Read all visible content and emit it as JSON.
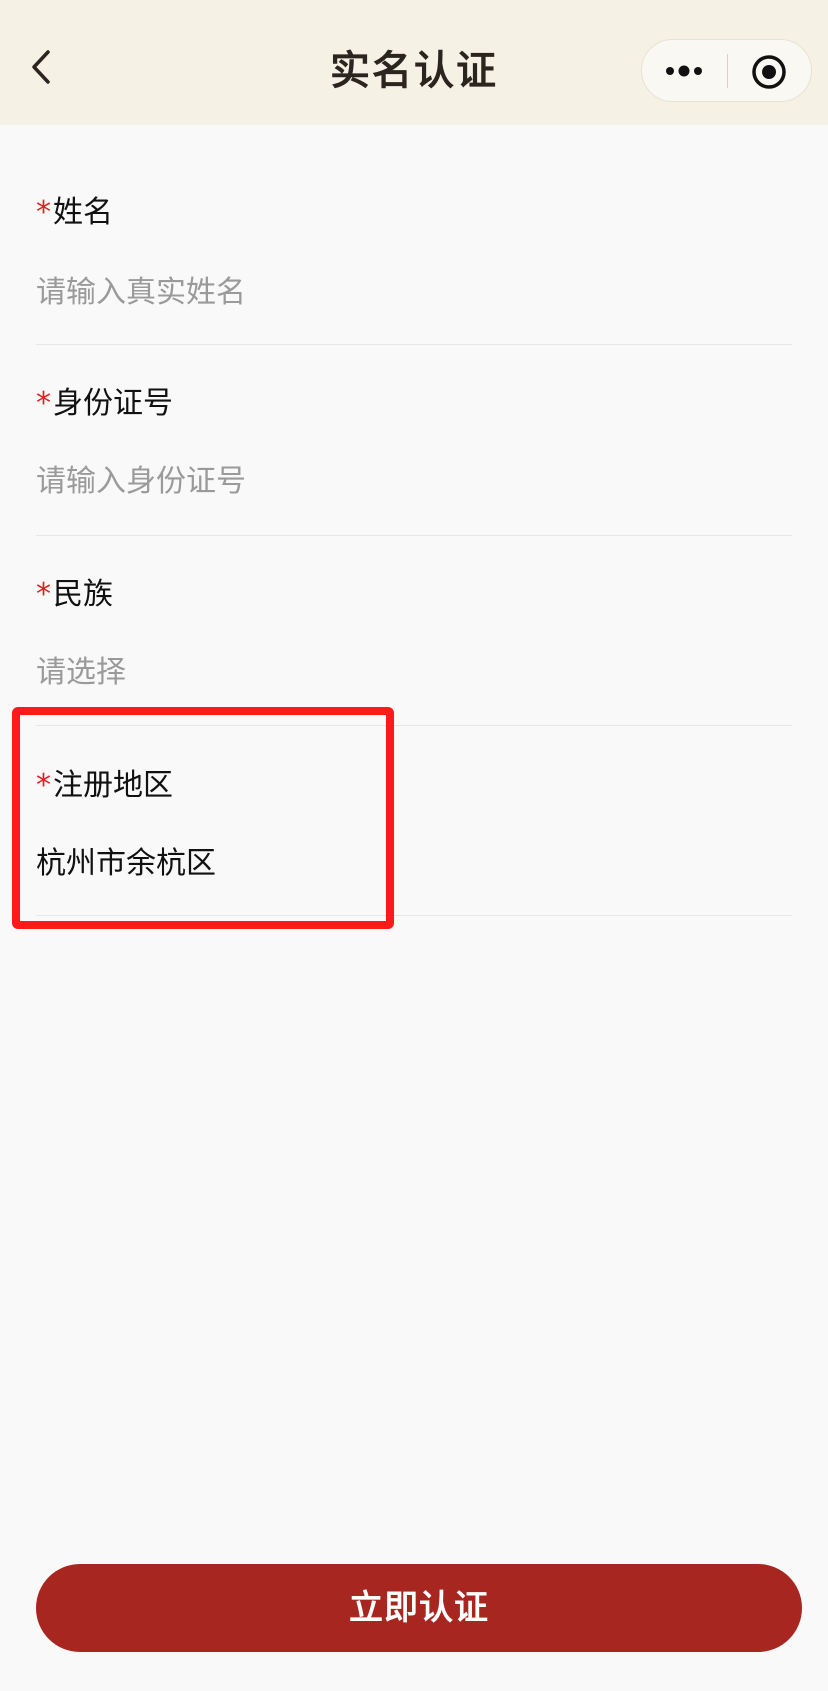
{
  "nav": {
    "title": "实名认证",
    "back_icon": "chevron-left-icon",
    "more_icon": "more-dots-icon",
    "close_icon": "target-close-icon"
  },
  "form": {
    "required_marker": "*",
    "fields": [
      {
        "label": "姓名",
        "placeholder": "请输入真实姓名",
        "value": ""
      },
      {
        "label": "身份证号",
        "placeholder": "请输入身份证号",
        "value": ""
      },
      {
        "label": "民族",
        "placeholder": "请选择",
        "value": ""
      },
      {
        "label": "注册地区",
        "placeholder": "",
        "value": "杭州市余杭区"
      }
    ]
  },
  "submit": {
    "label": "立即认证"
  },
  "colors": {
    "nav_bg": "#f6f1e5",
    "page_bg": "#f9f9f9",
    "required": "#e02020",
    "button_bg": "#a82620",
    "highlight": "#ff1a1a"
  }
}
